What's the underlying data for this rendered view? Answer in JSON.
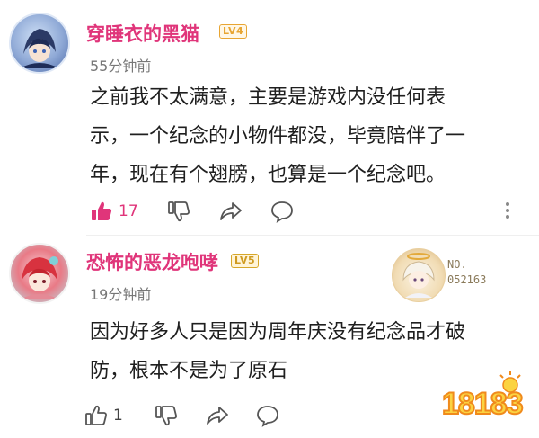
{
  "comments": [
    {
      "username": "穿睡衣的黑猫",
      "level": "LV4",
      "time": "55分钟前",
      "lines": [
        "之前我不太满意，主要是游戏内没任何表",
        "示，一个纪念的小物件都没，毕竟陪伴了一",
        "年，现在有个翅膀，也算是一个纪念吧。"
      ],
      "likes": "17",
      "liked": true,
      "avatar_icon": "anime-avatar-icon"
    },
    {
      "username": "恐怖的恶龙咆哮",
      "level": "LV5",
      "time": "19分钟前",
      "lines": [
        "因为好多人只是因为周年庆没有纪念品才破",
        "防，根本不是为了原石"
      ],
      "likes": "1",
      "liked": false,
      "avatar_icon": "anime-avatar-icon",
      "medal": {
        "no_label": "NO.",
        "number": "052163"
      }
    }
  ],
  "watermark": "18183",
  "colors": {
    "accent": "#e0357a",
    "badge_lv4": "#e8a532",
    "badge_lv5": "#cf9a1f",
    "muted": "#777777"
  }
}
